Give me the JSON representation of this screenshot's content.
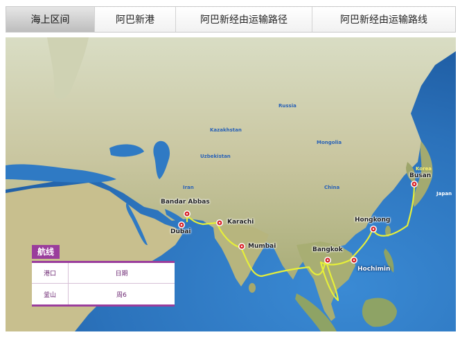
{
  "tabs": [
    {
      "label": "海上区间",
      "active": true
    },
    {
      "label": "阿巴新港",
      "active": false
    },
    {
      "label": "阿巴新经由运输路径",
      "active": false
    },
    {
      "label": "阿巴新经由运输路线",
      "active": false
    }
  ],
  "map": {
    "countries": {
      "russia": "Russia",
      "kazakhstan": "Kazakhstan",
      "mongolia": "Mongolia",
      "uzbekistan": "Uzbekistan",
      "china": "China",
      "iran": "Iran",
      "korea": "Korea",
      "japan": "Japan"
    },
    "ports": {
      "bandar_abbas": "Bandar Abbas",
      "dubai": "Dubai",
      "karachi": "Karachi",
      "mumbai": "Mumbai",
      "bangkok": "Bangkok",
      "hochimin": "Hochimin",
      "hongkong": "Hongkong",
      "busan": "Busan"
    },
    "route_color": "#e6ef3a",
    "port_marker_color": "#d8262c"
  },
  "legend": {
    "title": "航线",
    "header": {
      "col1": "港口",
      "col2": "日期"
    },
    "rows": [
      {
        "col1": "釜山",
        "col2": "周6"
      }
    ],
    "accent_color": "#9a3d9c"
  }
}
